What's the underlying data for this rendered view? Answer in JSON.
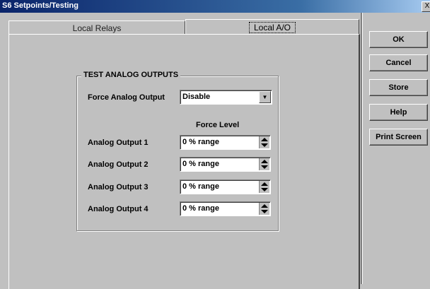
{
  "window": {
    "title": "S6 Setpoints/Testing",
    "close_label": "X"
  },
  "tabs": [
    {
      "label": "Local Relays"
    },
    {
      "label": "Local A/O"
    }
  ],
  "group": {
    "title": "TEST ANALOG OUTPUTS",
    "force_analog_output": {
      "label": "Force Analog Output",
      "value": "Disable"
    },
    "force_level_header": "Force Level",
    "outputs": [
      {
        "label": "Analog Output 1",
        "value": "0 % range"
      },
      {
        "label": "Analog Output 2",
        "value": "0 % range"
      },
      {
        "label": "Analog Output 3",
        "value": "0 % range"
      },
      {
        "label": "Analog Output 4",
        "value": "0 % range"
      }
    ]
  },
  "buttons": {
    "ok": "OK",
    "cancel": "Cancel",
    "store": "Store",
    "help": "Help",
    "print": "Print Screen"
  }
}
